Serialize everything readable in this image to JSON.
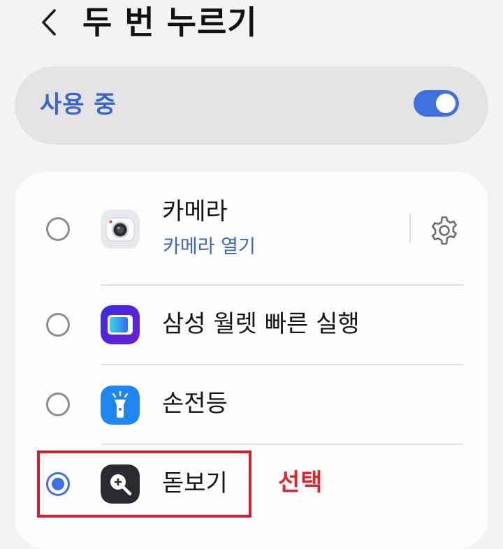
{
  "header": {
    "title": "두 번 누르기",
    "back_icon": "chevron-left-icon"
  },
  "master_switch": {
    "label": "사용 중",
    "enabled": true,
    "accent_color": "#3e70e0"
  },
  "options": [
    {
      "title": "카메라",
      "subtitle": "카메라 열기",
      "icon": "camera-app-icon",
      "selected": false,
      "has_settings": true
    },
    {
      "title": "삼성 월렛 빠른 실행",
      "icon": "samsung-wallet-app-icon",
      "selected": false,
      "has_settings": false
    },
    {
      "title": "손전등",
      "icon": "flashlight-app-icon",
      "selected": false,
      "has_settings": false
    },
    {
      "title": "돋보기",
      "icon": "magnifier-app-icon",
      "selected": true,
      "has_settings": false
    }
  ],
  "annotation": {
    "label": "선택",
    "color": "#e0222b"
  }
}
